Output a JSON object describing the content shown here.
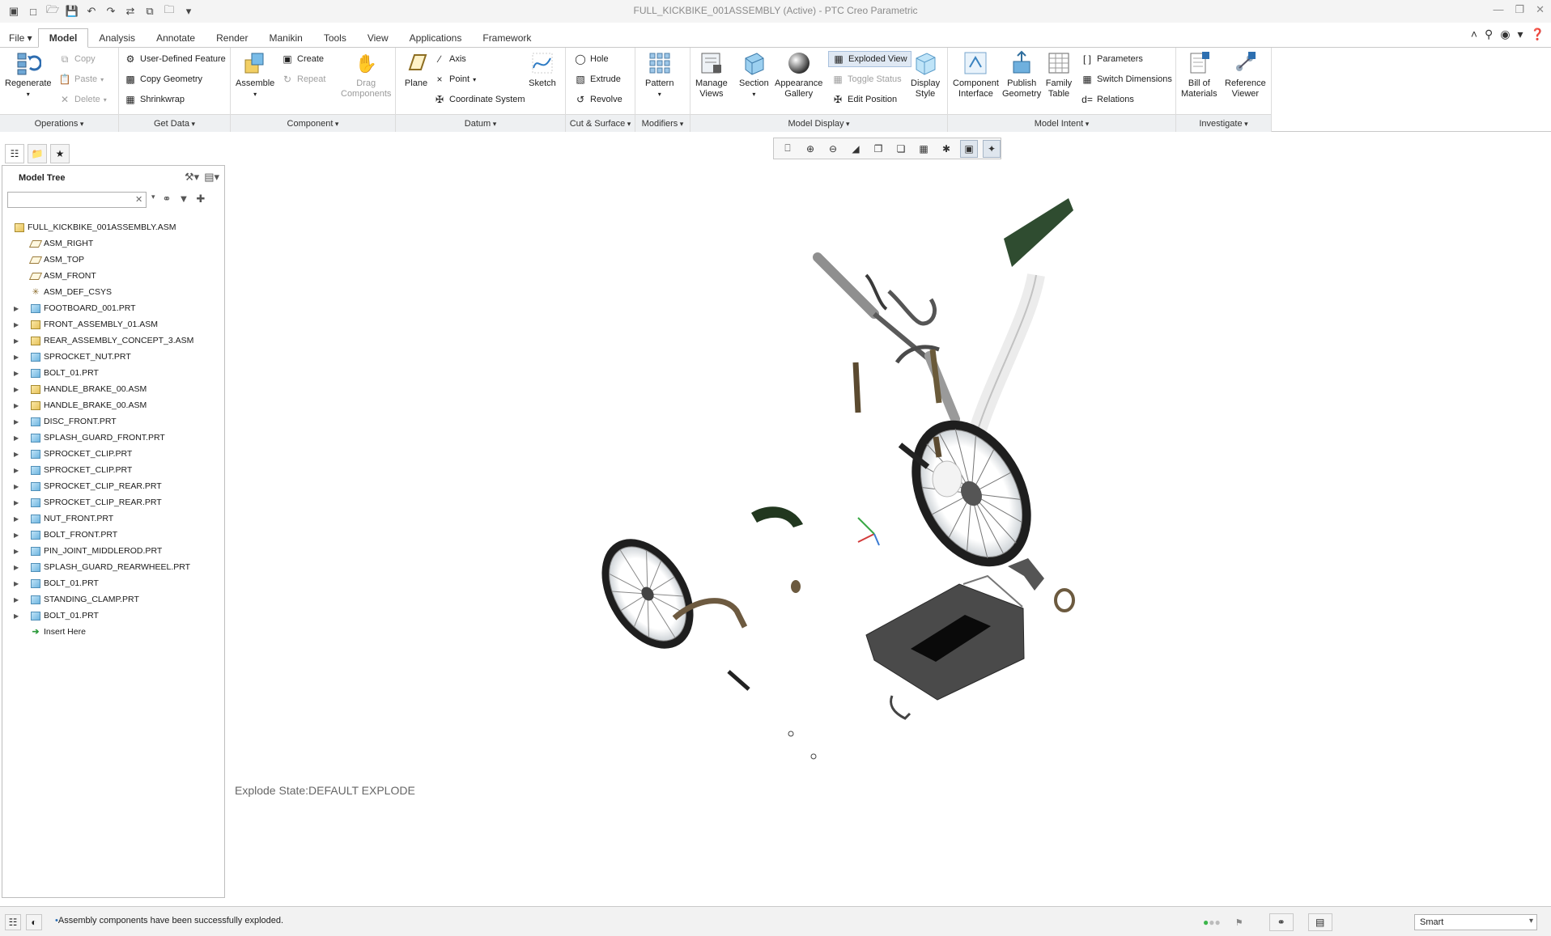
{
  "window": {
    "title": "FULL_KICKBIKE_001ASSEMBLY (Active) - PTC Creo Parametric"
  },
  "ribbon_tabs": [
    "File",
    "Model",
    "Analysis",
    "Annotate",
    "Render",
    "Manikin",
    "Tools",
    "View",
    "Applications",
    "Framework"
  ],
  "active_tab": "Model",
  "ribbon": {
    "operations": {
      "label": "Operations",
      "regenerate": "Regenerate",
      "copy": "Copy",
      "paste": "Paste",
      "delete": "Delete"
    },
    "get_data": {
      "label": "Get Data",
      "user_defined_feature": "User-Defined Feature",
      "copy_geometry": "Copy Geometry",
      "shrinkwrap": "Shrinkwrap"
    },
    "component": {
      "label": "Component",
      "assemble": "Assemble",
      "create": "Create",
      "repeat": "Repeat",
      "drag_components_1": "Drag",
      "drag_components_2": "Components"
    },
    "datum": {
      "label": "Datum",
      "plane": "Plane",
      "axis": "Axis",
      "point": "Point",
      "coordinate_system": "Coordinate System",
      "sketch": "Sketch"
    },
    "cut_surface": {
      "label": "Cut & Surface",
      "hole": "Hole",
      "extrude": "Extrude",
      "revolve": "Revolve"
    },
    "modifiers": {
      "label": "Modifiers",
      "pattern": "Pattern"
    },
    "model_display": {
      "label": "Model Display",
      "manage_views_1": "Manage",
      "manage_views_2": "Views",
      "section": "Section",
      "appearance_gallery_1": "Appearance",
      "appearance_gallery_2": "Gallery",
      "exploded_view": "Exploded View",
      "toggle_status": "Toggle Status",
      "edit_position": "Edit Position",
      "display_style_1": "Display",
      "display_style_2": "Style"
    },
    "model_intent": {
      "label": "Model Intent",
      "component_interface_1": "Component",
      "component_interface_2": "Interface",
      "publish_geometry_1": "Publish",
      "publish_geometry_2": "Geometry",
      "family_table_1": "Family",
      "family_table_2": "Table",
      "parameters": "Parameters",
      "switch_dimensions": "Switch Dimensions",
      "relations": "Relations"
    },
    "investigate": {
      "label": "Investigate",
      "bill_of_materials_1": "Bill of",
      "bill_of_materials_2": "Materials",
      "reference_viewer_1": "Reference",
      "reference_viewer_2": "Viewer"
    }
  },
  "model_tree": {
    "header": "Model Tree",
    "search": {
      "value": "",
      "placeholder": ""
    },
    "items": [
      {
        "label": "FULL_KICKBIKE_001ASSEMBLY.ASM",
        "type": "root-asm",
        "expandable": false
      },
      {
        "label": "ASM_RIGHT",
        "type": "plane",
        "expandable": false
      },
      {
        "label": "ASM_TOP",
        "type": "plane",
        "expandable": false
      },
      {
        "label": "ASM_FRONT",
        "type": "plane",
        "expandable": false
      },
      {
        "label": "ASM_DEF_CSYS",
        "type": "csys",
        "expandable": false
      },
      {
        "label": "FOOTBOARD_001.PRT",
        "type": "part",
        "expandable": true
      },
      {
        "label": "FRONT_ASSEMBLY_01.ASM",
        "type": "asm",
        "expandable": true
      },
      {
        "label": "REAR_ASSEMBLY_CONCEPT_3.ASM",
        "type": "asm",
        "expandable": true
      },
      {
        "label": "SPROCKET_NUT.PRT",
        "type": "part",
        "expandable": true
      },
      {
        "label": "BOLT_01.PRT",
        "type": "part",
        "expandable": true
      },
      {
        "label": "HANDLE_BRAKE_00.ASM",
        "type": "asm",
        "expandable": true
      },
      {
        "label": "HANDLE_BRAKE_00.ASM",
        "type": "asm",
        "expandable": true
      },
      {
        "label": "DISC_FRONT.PRT",
        "type": "part",
        "expandable": true
      },
      {
        "label": "SPLASH_GUARD_FRONT.PRT",
        "type": "part",
        "expandable": true
      },
      {
        "label": "SPROCKET_CLIP.PRT",
        "type": "part",
        "expandable": true
      },
      {
        "label": "SPROCKET_CLIP.PRT",
        "type": "part",
        "expandable": true
      },
      {
        "label": "SPROCKET_CLIP_REAR.PRT",
        "type": "part",
        "expandable": true
      },
      {
        "label": "SPROCKET_CLIP_REAR.PRT",
        "type": "part",
        "expandable": true
      },
      {
        "label": "NUT_FRONT.PRT",
        "type": "part",
        "expandable": true
      },
      {
        "label": "BOLT_FRONT.PRT",
        "type": "part",
        "expandable": true
      },
      {
        "label": "PIN_JOINT_MIDDLEROD.PRT",
        "type": "part",
        "expandable": true
      },
      {
        "label": "SPLASH_GUARD_REARWHEEL.PRT",
        "type": "part",
        "expandable": true
      },
      {
        "label": "BOLT_01.PRT",
        "type": "part",
        "expandable": true
      },
      {
        "label": "STANDING_CLAMP.PRT",
        "type": "part",
        "expandable": true
      },
      {
        "label": "BOLT_01.PRT",
        "type": "part",
        "expandable": true
      },
      {
        "label": "Insert Here",
        "type": "insert",
        "expandable": false
      }
    ]
  },
  "viewport": {
    "explode_state": "Explode State:DEFAULT EXPLODE"
  },
  "status": {
    "message": "Assembly components have been successfully exploded.",
    "filter_value": "Smart"
  },
  "colors": {
    "accent": "#2b6fb6",
    "fender_green": "#25402a",
    "frame_gray": "#4a4a4a"
  }
}
